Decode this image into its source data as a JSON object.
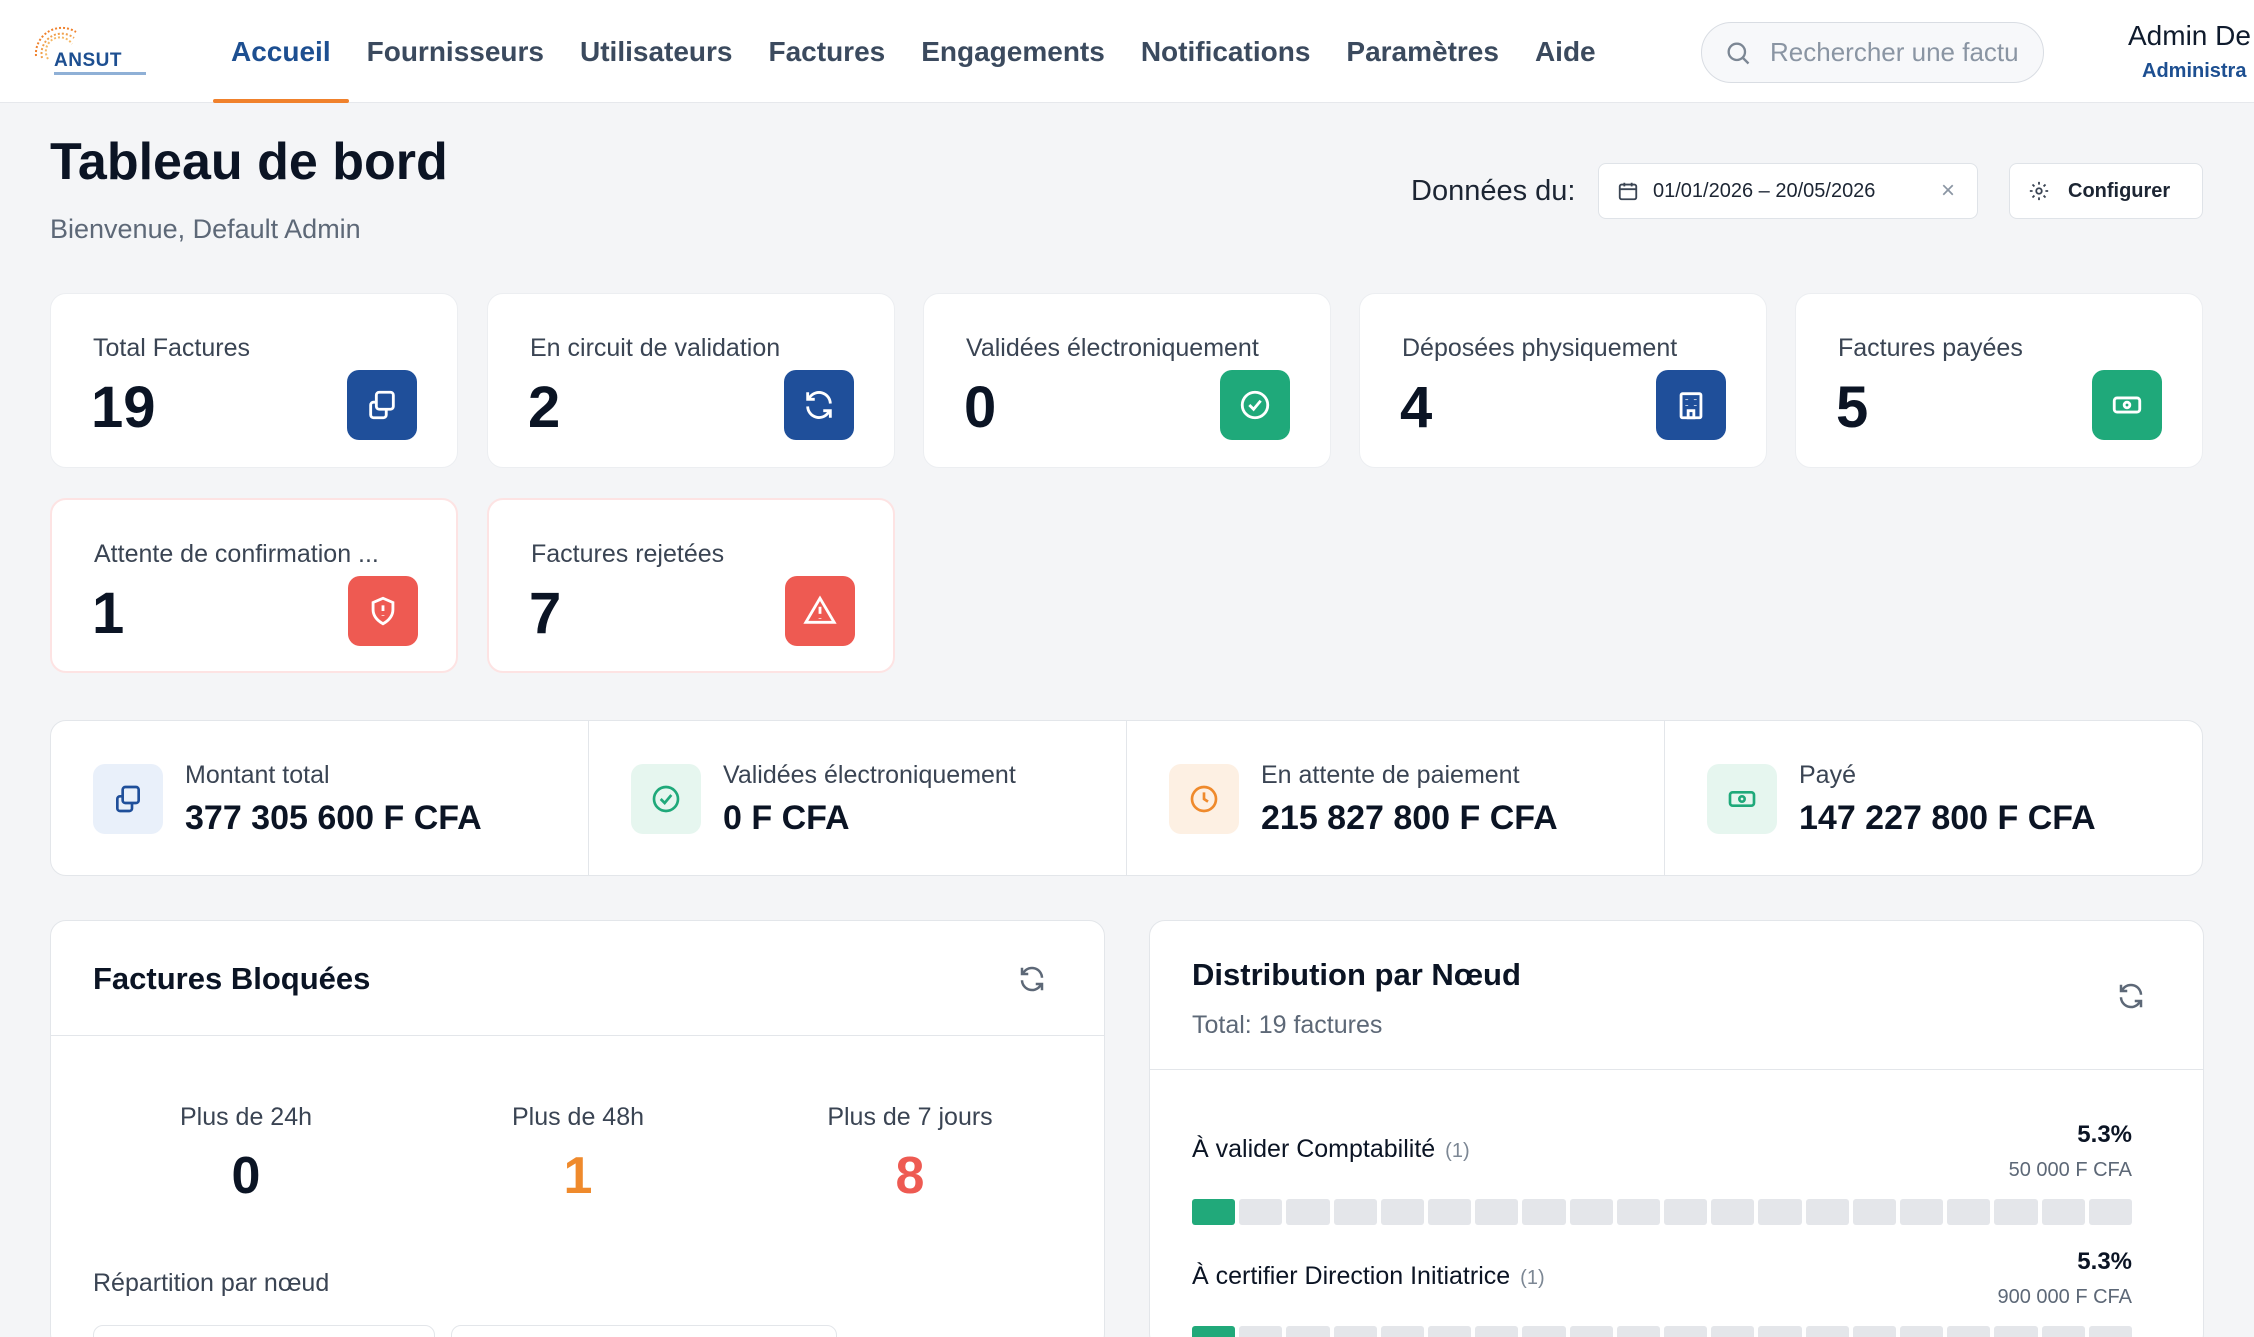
{
  "header": {
    "logo_text": "ANSUT",
    "nav": [
      "Accueil",
      "Fournisseurs",
      "Utilisateurs",
      "Factures",
      "Engagements",
      "Notifications",
      "Paramètres",
      "Aide"
    ],
    "active_nav": "Accueil",
    "search_placeholder": "Rechercher une facture...",
    "user_name": "Admin De",
    "user_role": "Administra"
  },
  "page": {
    "title": "Tableau de bord",
    "subtitle": "Bienvenue, Default Admin",
    "date_label": "Données du:",
    "date_range": "01/01/2026 – 20/05/2026",
    "configure_label": "Configurer"
  },
  "stats": [
    {
      "label": "Total Factures",
      "value": "19",
      "icon": "copy-icon",
      "color": "#1f4f9a"
    },
    {
      "label": "En circuit de validation",
      "value": "2",
      "icon": "refresh-icon",
      "color": "#1f4f9a"
    },
    {
      "label": "Validées électroniquement",
      "value": "0",
      "icon": "check-circle-icon",
      "color": "#1fa97a"
    },
    {
      "label": "Déposées physiquement",
      "value": "4",
      "icon": "building-icon",
      "color": "#1f4f9a"
    },
    {
      "label": "Factures payées",
      "value": "5",
      "icon": "banknote-icon",
      "color": "#1fa97a"
    },
    {
      "label": "Attente de confirmation ...",
      "value": "1",
      "icon": "shield-alert-icon",
      "color": "#ee5a52"
    },
    {
      "label": "Factures rejetées",
      "value": "7",
      "icon": "warning-icon",
      "color": "#ee5a52"
    }
  ],
  "amounts": [
    {
      "label": "Montant total",
      "value": "377 305 600 F CFA",
      "icon": "copy-icon",
      "bg": "#e9f0fa",
      "fg": "#1f4f9a"
    },
    {
      "label": "Validées électroniquement",
      "value": "0 F CFA",
      "icon": "check-circle-icon",
      "bg": "#e6f6ef",
      "fg": "#1fa97a"
    },
    {
      "label": "En attente de paiement",
      "value": "215 827 800 F CFA",
      "icon": "clock-icon",
      "bg": "#fdf0e3",
      "fg": "#ef8a2c"
    },
    {
      "label": "Payé",
      "value": "147 227 800 F CFA",
      "icon": "banknote-icon",
      "bg": "#e6f6ef",
      "fg": "#1fa97a"
    }
  ],
  "blocked": {
    "title": "Factures Bloquées",
    "columns": [
      {
        "label": "Plus de 24h",
        "value": "0",
        "color": "#0b1424"
      },
      {
        "label": "Plus de 48h",
        "value": "1",
        "color": "#ef8a2c"
      },
      {
        "label": "Plus de 7 jours",
        "value": "8",
        "color": "#ee5a52"
      }
    ],
    "repartition_label": "Répartition par nœud"
  },
  "distribution": {
    "title": "Distribution par Nœud",
    "total": "Total: 19 factures",
    "nodes": [
      {
        "label": "À valider Comptabilité",
        "count": "(1)",
        "percent": "5.3%",
        "amount": "50 000 F CFA",
        "fill": 0.053
      },
      {
        "label": "À certifier Direction Initiatrice",
        "count": "(1)",
        "percent": "5.3%",
        "amount": "900 000 F CFA",
        "fill": 0.053
      }
    ]
  }
}
